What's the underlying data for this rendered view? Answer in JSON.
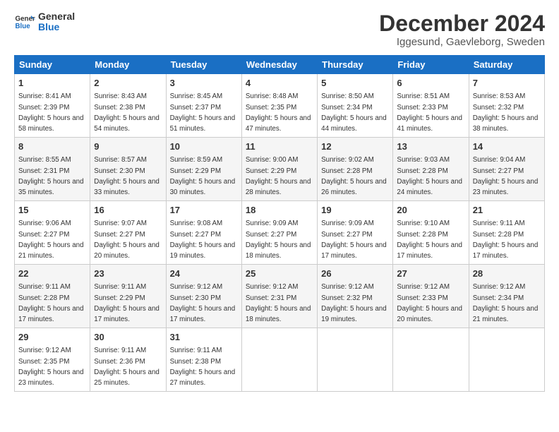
{
  "logo": {
    "line1": "General",
    "line2": "Blue"
  },
  "title": "December 2024",
  "subtitle": "Iggesund, Gaevleborg, Sweden",
  "weekdays": [
    "Sunday",
    "Monday",
    "Tuesday",
    "Wednesday",
    "Thursday",
    "Friday",
    "Saturday"
  ],
  "weeks": [
    [
      {
        "day": "1",
        "sunrise": "Sunrise: 8:41 AM",
        "sunset": "Sunset: 2:39 PM",
        "daylight": "Daylight: 5 hours and 58 minutes."
      },
      {
        "day": "2",
        "sunrise": "Sunrise: 8:43 AM",
        "sunset": "Sunset: 2:38 PM",
        "daylight": "Daylight: 5 hours and 54 minutes."
      },
      {
        "day": "3",
        "sunrise": "Sunrise: 8:45 AM",
        "sunset": "Sunset: 2:37 PM",
        "daylight": "Daylight: 5 hours and 51 minutes."
      },
      {
        "day": "4",
        "sunrise": "Sunrise: 8:48 AM",
        "sunset": "Sunset: 2:35 PM",
        "daylight": "Daylight: 5 hours and 47 minutes."
      },
      {
        "day": "5",
        "sunrise": "Sunrise: 8:50 AM",
        "sunset": "Sunset: 2:34 PM",
        "daylight": "Daylight: 5 hours and 44 minutes."
      },
      {
        "day": "6",
        "sunrise": "Sunrise: 8:51 AM",
        "sunset": "Sunset: 2:33 PM",
        "daylight": "Daylight: 5 hours and 41 minutes."
      },
      {
        "day": "7",
        "sunrise": "Sunrise: 8:53 AM",
        "sunset": "Sunset: 2:32 PM",
        "daylight": "Daylight: 5 hours and 38 minutes."
      }
    ],
    [
      {
        "day": "8",
        "sunrise": "Sunrise: 8:55 AM",
        "sunset": "Sunset: 2:31 PM",
        "daylight": "Daylight: 5 hours and 35 minutes."
      },
      {
        "day": "9",
        "sunrise": "Sunrise: 8:57 AM",
        "sunset": "Sunset: 2:30 PM",
        "daylight": "Daylight: 5 hours and 33 minutes."
      },
      {
        "day": "10",
        "sunrise": "Sunrise: 8:59 AM",
        "sunset": "Sunset: 2:29 PM",
        "daylight": "Daylight: 5 hours and 30 minutes."
      },
      {
        "day": "11",
        "sunrise": "Sunrise: 9:00 AM",
        "sunset": "Sunset: 2:29 PM",
        "daylight": "Daylight: 5 hours and 28 minutes."
      },
      {
        "day": "12",
        "sunrise": "Sunrise: 9:02 AM",
        "sunset": "Sunset: 2:28 PM",
        "daylight": "Daylight: 5 hours and 26 minutes."
      },
      {
        "day": "13",
        "sunrise": "Sunrise: 9:03 AM",
        "sunset": "Sunset: 2:28 PM",
        "daylight": "Daylight: 5 hours and 24 minutes."
      },
      {
        "day": "14",
        "sunrise": "Sunrise: 9:04 AM",
        "sunset": "Sunset: 2:27 PM",
        "daylight": "Daylight: 5 hours and 23 minutes."
      }
    ],
    [
      {
        "day": "15",
        "sunrise": "Sunrise: 9:06 AM",
        "sunset": "Sunset: 2:27 PM",
        "daylight": "Daylight: 5 hours and 21 minutes."
      },
      {
        "day": "16",
        "sunrise": "Sunrise: 9:07 AM",
        "sunset": "Sunset: 2:27 PM",
        "daylight": "Daylight: 5 hours and 20 minutes."
      },
      {
        "day": "17",
        "sunrise": "Sunrise: 9:08 AM",
        "sunset": "Sunset: 2:27 PM",
        "daylight": "Daylight: 5 hours and 19 minutes."
      },
      {
        "day": "18",
        "sunrise": "Sunrise: 9:09 AM",
        "sunset": "Sunset: 2:27 PM",
        "daylight": "Daylight: 5 hours and 18 minutes."
      },
      {
        "day": "19",
        "sunrise": "Sunrise: 9:09 AM",
        "sunset": "Sunset: 2:27 PM",
        "daylight": "Daylight: 5 hours and 17 minutes."
      },
      {
        "day": "20",
        "sunrise": "Sunrise: 9:10 AM",
        "sunset": "Sunset: 2:28 PM",
        "daylight": "Daylight: 5 hours and 17 minutes."
      },
      {
        "day": "21",
        "sunrise": "Sunrise: 9:11 AM",
        "sunset": "Sunset: 2:28 PM",
        "daylight": "Daylight: 5 hours and 17 minutes."
      }
    ],
    [
      {
        "day": "22",
        "sunrise": "Sunrise: 9:11 AM",
        "sunset": "Sunset: 2:28 PM",
        "daylight": "Daylight: 5 hours and 17 minutes."
      },
      {
        "day": "23",
        "sunrise": "Sunrise: 9:11 AM",
        "sunset": "Sunset: 2:29 PM",
        "daylight": "Daylight: 5 hours and 17 minutes."
      },
      {
        "day": "24",
        "sunrise": "Sunrise: 9:12 AM",
        "sunset": "Sunset: 2:30 PM",
        "daylight": "Daylight: 5 hours and 17 minutes."
      },
      {
        "day": "25",
        "sunrise": "Sunrise: 9:12 AM",
        "sunset": "Sunset: 2:31 PM",
        "daylight": "Daylight: 5 hours and 18 minutes."
      },
      {
        "day": "26",
        "sunrise": "Sunrise: 9:12 AM",
        "sunset": "Sunset: 2:32 PM",
        "daylight": "Daylight: 5 hours and 19 minutes."
      },
      {
        "day": "27",
        "sunrise": "Sunrise: 9:12 AM",
        "sunset": "Sunset: 2:33 PM",
        "daylight": "Daylight: 5 hours and 20 minutes."
      },
      {
        "day": "28",
        "sunrise": "Sunrise: 9:12 AM",
        "sunset": "Sunset: 2:34 PM",
        "daylight": "Daylight: 5 hours and 21 minutes."
      }
    ],
    [
      {
        "day": "29",
        "sunrise": "Sunrise: 9:12 AM",
        "sunset": "Sunset: 2:35 PM",
        "daylight": "Daylight: 5 hours and 23 minutes."
      },
      {
        "day": "30",
        "sunrise": "Sunrise: 9:11 AM",
        "sunset": "Sunset: 2:36 PM",
        "daylight": "Daylight: 5 hours and 25 minutes."
      },
      {
        "day": "31",
        "sunrise": "Sunrise: 9:11 AM",
        "sunset": "Sunset: 2:38 PM",
        "daylight": "Daylight: 5 hours and 27 minutes."
      },
      null,
      null,
      null,
      null
    ]
  ]
}
